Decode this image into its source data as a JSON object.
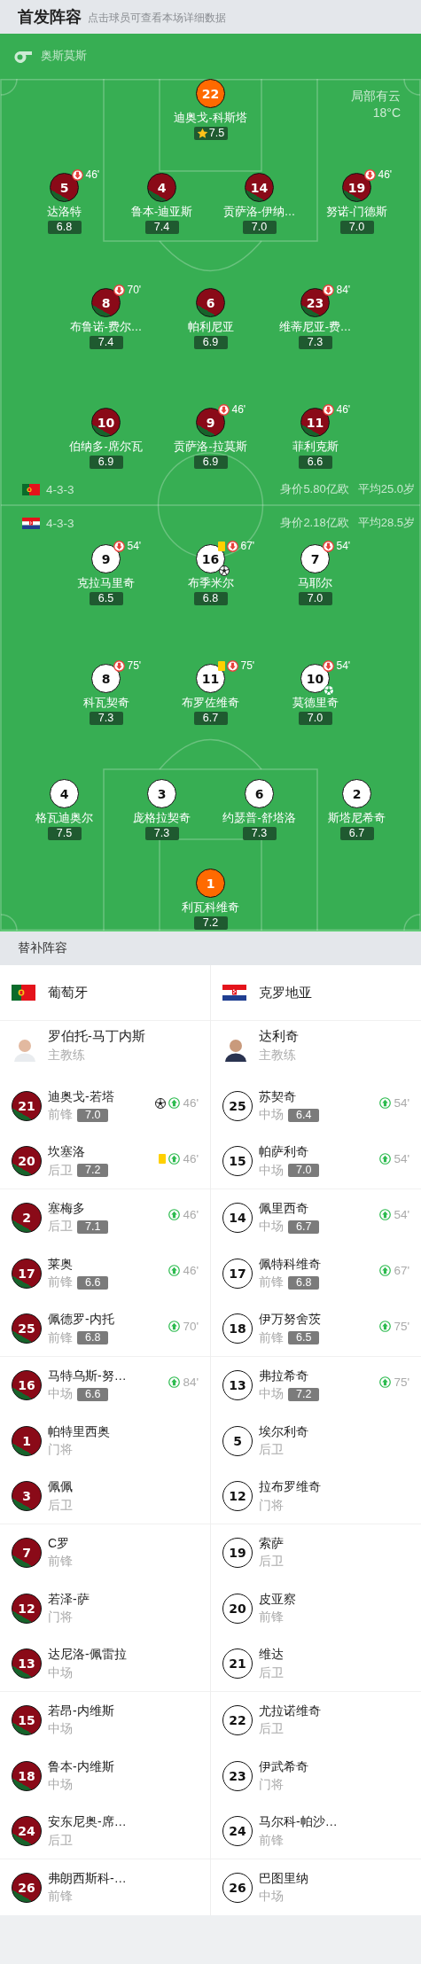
{
  "header": {
    "title": "首发阵容",
    "hint": "点击球员可查看本场详细数据"
  },
  "lineup": {
    "referee": "奥斯莫斯",
    "weather": "局部有云",
    "temperature": "18°C",
    "teams": [
      {
        "formation": "4-3-3",
        "value": "身价5.80亿欧",
        "avg_age": "平均25.0岁",
        "lines": [
          {
            "kind": "goalkeeper",
            "players": [
              {
                "number": "22",
                "name": "迪奥戈-科斯塔",
                "rating": "7.5",
                "best": true
              }
            ]
          },
          {
            "kind": "outfield",
            "players": [
              {
                "number": "5",
                "name": "达洛特",
                "rating": "6.8",
                "sub_off": "46'"
              },
              {
                "number": "4",
                "name": "鲁本-迪亚斯",
                "rating": "7.4"
              },
              {
                "number": "14",
                "name": "贡萨洛-伊纳…",
                "rating": "7.0"
              },
              {
                "number": "19",
                "name": "努诺-门德斯",
                "rating": "7.0",
                "sub_off": "46'"
              }
            ]
          },
          {
            "kind": "outfield",
            "players": [
              {
                "number": "8",
                "name": "布鲁诺-费尔…",
                "rating": "7.4",
                "sub_off": "70'"
              },
              {
                "number": "6",
                "name": "帕利尼亚",
                "rating": "6.9"
              },
              {
                "number": "23",
                "name": "维蒂尼亚-费…",
                "rating": "7.3",
                "sub_off": "84'"
              }
            ]
          },
          {
            "kind": "outfield",
            "players": [
              {
                "number": "10",
                "name": "伯纳多-席尔瓦",
                "rating": "6.9"
              },
              {
                "number": "9",
                "name": "贡萨洛-拉莫斯",
                "rating": "6.9",
                "sub_off": "46'"
              },
              {
                "number": "11",
                "name": "菲利克斯",
                "rating": "6.6",
                "sub_off": "46'"
              }
            ]
          }
        ]
      },
      {
        "formation": "4-3-3",
        "value": "身价2.18亿欧",
        "avg_age": "平均28.5岁",
        "lines": [
          {
            "kind": "outfield",
            "players": [
              {
                "number": "9",
                "name": "克拉马里奇",
                "rating": "6.5",
                "sub_off": "54'"
              },
              {
                "number": "16",
                "name": "布季米尔",
                "rating": "6.8",
                "sub_off": "67'",
                "yellow_card": true,
                "goal": true
              },
              {
                "number": "7",
                "name": "马耶尔",
                "rating": "7.0",
                "sub_off": "54'"
              }
            ]
          },
          {
            "kind": "outfield",
            "players": [
              {
                "number": "8",
                "name": "科瓦契奇",
                "rating": "7.3",
                "sub_off": "75'"
              },
              {
                "number": "11",
                "name": "布罗佐维奇",
                "rating": "6.7",
                "sub_off": "75'",
                "yellow_card": true
              },
              {
                "number": "10",
                "name": "莫德里奇",
                "rating": "7.0",
                "sub_off": "54'",
                "assist": true
              }
            ]
          },
          {
            "kind": "outfield",
            "players": [
              {
                "number": "4",
                "name": "格瓦迪奥尔",
                "rating": "7.5"
              },
              {
                "number": "3",
                "name": "庞格拉契奇",
                "rating": "7.3"
              },
              {
                "number": "6",
                "name": "约瑟普-舒塔洛",
                "rating": "7.3"
              },
              {
                "number": "2",
                "name": "斯塔尼希奇",
                "rating": "6.7"
              }
            ]
          },
          {
            "kind": "goalkeeper",
            "players": [
              {
                "number": "1",
                "name": "利瓦科维奇",
                "rating": "7.2"
              }
            ]
          }
        ]
      }
    ]
  },
  "substitutes": {
    "title": "替补阵容",
    "teams": [
      {
        "name": "葡萄牙",
        "coach": {
          "name": "罗伯托-马丁内斯",
          "role": "主教练"
        },
        "players": [
          {
            "number": "21",
            "name": "迪奥戈-若塔",
            "position": "前锋",
            "rating": "7.0",
            "sub_on": "46'",
            "goal": true
          },
          {
            "number": "20",
            "name": "坎塞洛",
            "position": "后卫",
            "rating": "7.2",
            "sub_on": "46'",
            "yellow_card": true
          },
          {
            "number": "2",
            "name": "塞梅多",
            "position": "后卫",
            "rating": "7.1",
            "sub_on": "46'"
          },
          {
            "number": "17",
            "name": "莱奥",
            "position": "前锋",
            "rating": "6.6",
            "sub_on": "46'"
          },
          {
            "number": "25",
            "name": "佩德罗-内托",
            "position": "前锋",
            "rating": "6.8",
            "sub_on": "70'"
          },
          {
            "number": "16",
            "name": "马特乌斯-努…",
            "position": "中场",
            "rating": "6.6",
            "sub_on": "84'"
          },
          {
            "number": "1",
            "name": "帕特里西奥",
            "position": "门将"
          },
          {
            "number": "3",
            "name": "佩佩",
            "position": "后卫"
          },
          {
            "number": "7",
            "name": "C罗",
            "position": "前锋"
          },
          {
            "number": "12",
            "name": "若泽-萨",
            "position": "门将"
          },
          {
            "number": "13",
            "name": "达尼洛-佩雷拉",
            "position": "中场"
          },
          {
            "number": "15",
            "name": "若昂-内维斯",
            "position": "中场"
          },
          {
            "number": "18",
            "name": "鲁本-内维斯",
            "position": "中场"
          },
          {
            "number": "24",
            "name": "安东尼奥-席…",
            "position": "后卫"
          },
          {
            "number": "26",
            "name": "弗朗西斯科-…",
            "position": "前锋"
          }
        ]
      },
      {
        "name": "克罗地亚",
        "coach": {
          "name": "达利奇",
          "role": "主教练"
        },
        "players": [
          {
            "number": "25",
            "name": "苏契奇",
            "position": "中场",
            "rating": "6.4",
            "sub_on": "54'"
          },
          {
            "number": "15",
            "name": "帕萨利奇",
            "position": "中场",
            "rating": "7.0",
            "sub_on": "54'"
          },
          {
            "number": "14",
            "name": "佩里西奇",
            "position": "中场",
            "rating": "6.7",
            "sub_on": "54'"
          },
          {
            "number": "17",
            "name": "佩特科维奇",
            "position": "前锋",
            "rating": "6.8",
            "sub_on": "67'"
          },
          {
            "number": "18",
            "name": "伊万努舍茨",
            "position": "前锋",
            "rating": "6.5",
            "sub_on": "75'"
          },
          {
            "number": "13",
            "name": "弗拉希奇",
            "position": "中场",
            "rating": "7.2",
            "sub_on": "75'"
          },
          {
            "number": "5",
            "name": "埃尔利奇",
            "position": "后卫"
          },
          {
            "number": "12",
            "name": "拉布罗维奇",
            "position": "门将"
          },
          {
            "number": "19",
            "name": "索萨",
            "position": "后卫"
          },
          {
            "number": "20",
            "name": "皮亚察",
            "position": "前锋"
          },
          {
            "number": "21",
            "name": "维达",
            "position": "后卫"
          },
          {
            "number": "22",
            "name": "尤拉诺维奇",
            "position": "后卫"
          },
          {
            "number": "23",
            "name": "伊武希奇",
            "position": "门将"
          },
          {
            "number": "24",
            "name": "马尔科-帕沙…",
            "position": "前锋"
          },
          {
            "number": "26",
            "name": "巴图里纳",
            "position": "中场"
          }
        ]
      }
    ]
  }
}
